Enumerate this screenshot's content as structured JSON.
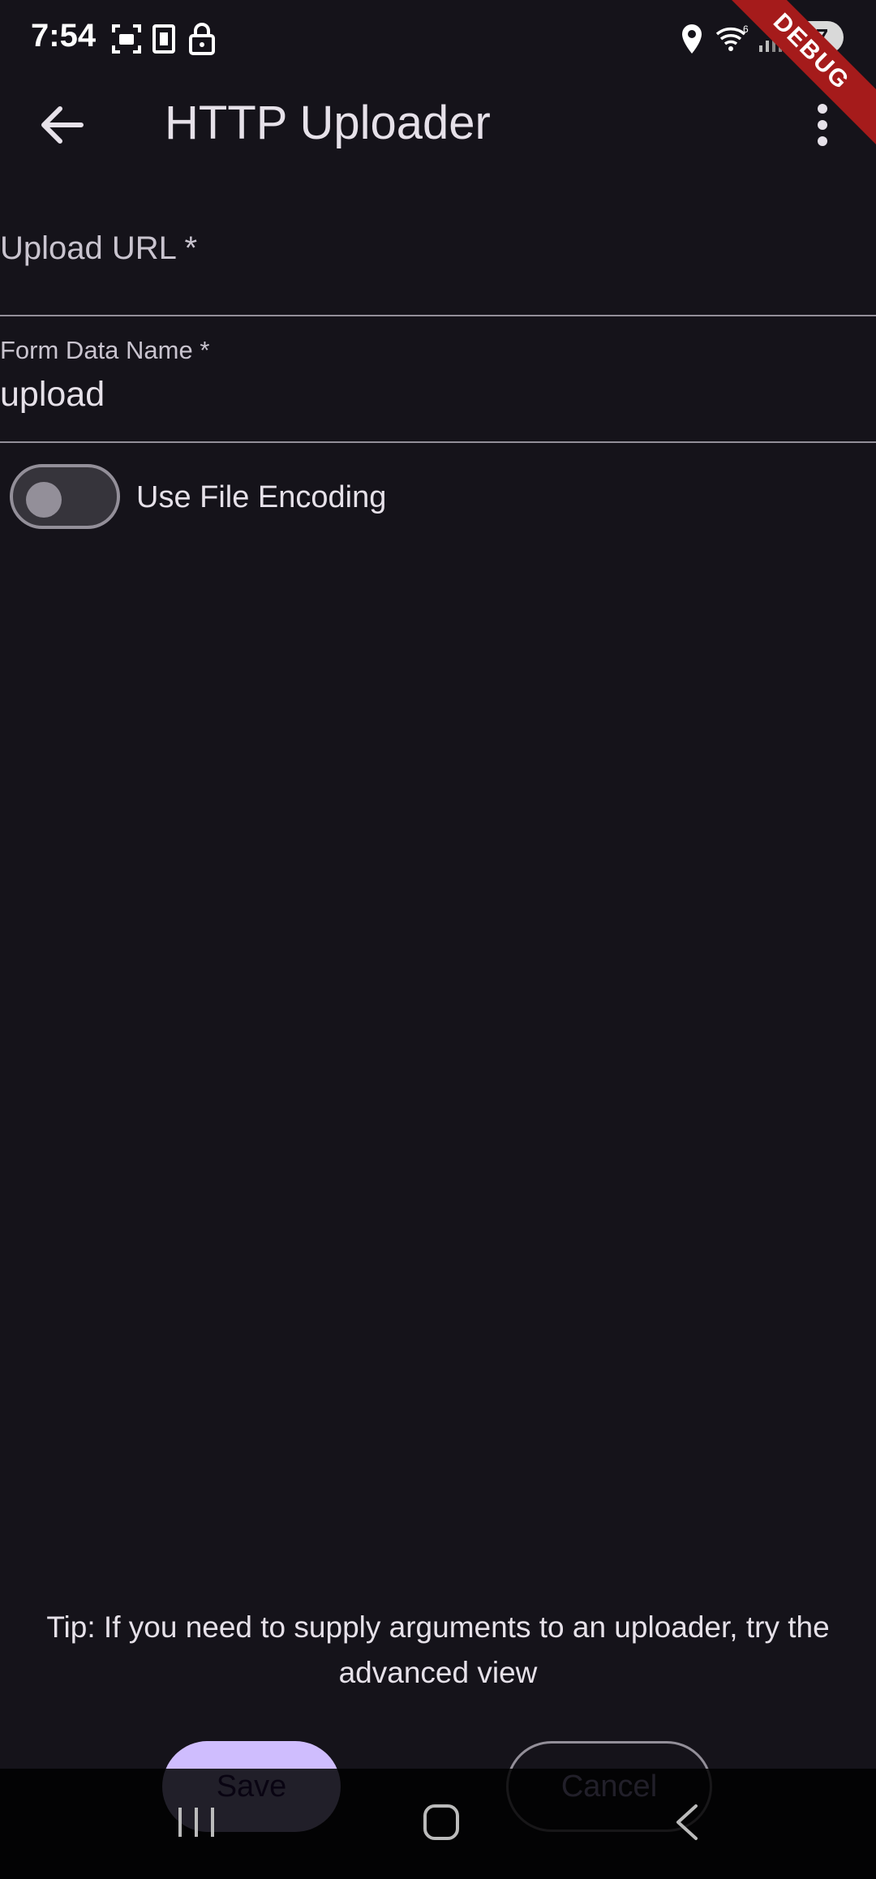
{
  "status_bar": {
    "time": "7:54",
    "battery": "67",
    "icons": [
      "screenshot-icon",
      "sim-icon",
      "lock-icon",
      "location-icon",
      "wifi-icon",
      "signal-icon",
      "battery-icon"
    ]
  },
  "debug_banner": "DEBUG",
  "app_bar": {
    "title": "HTTP Uploader",
    "back_icon": "arrow-left-icon",
    "menu_icon": "more-vert-icon"
  },
  "form": {
    "upload_url": {
      "placeholder": "Upload URL *",
      "value": ""
    },
    "form_data_name": {
      "label": "Form Data Name *",
      "value": "upload"
    },
    "use_file_encoding": {
      "label": "Use File Encoding",
      "enabled": false
    }
  },
  "tip": "Tip: If you need to supply arguments to an uploader, try the advanced view",
  "buttons": {
    "save": "Save",
    "cancel": "Cancel"
  },
  "nav_bar": {
    "icons": [
      "recents-icon",
      "home-icon",
      "back-icon"
    ]
  },
  "colors": {
    "background": "#15131a",
    "primary": "#cfbdfe",
    "outline": "#938f99",
    "debug": "#a51b1b"
  }
}
